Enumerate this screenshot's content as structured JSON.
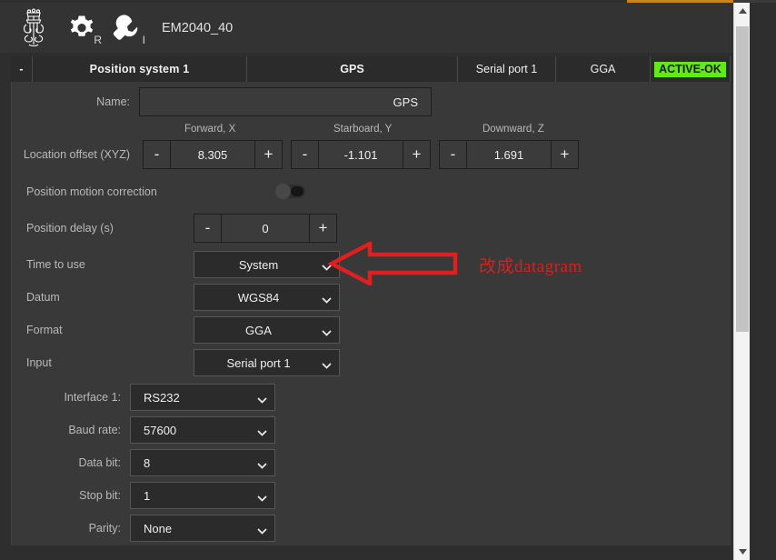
{
  "titlebar": {
    "logo_name": "kongsberg-crown-logo",
    "gear_sub": "R",
    "wrench_sub": "I",
    "device_name": "EM2040_40"
  },
  "tabstrip": {
    "collapse_label": "-",
    "title": "Position system 1",
    "name_tab": "GPS",
    "port_tab": "Serial port 1",
    "format_tab": "GGA",
    "status": "ACTIVE-OK",
    "status_color": "#63e81a"
  },
  "form": {
    "name": {
      "label": "Name:",
      "value": "GPS"
    },
    "location_offset": {
      "label": "Location offset (XYZ)",
      "axes": [
        {
          "header": "Forward, X",
          "value": "8.305",
          "minus": "-",
          "plus": "+"
        },
        {
          "header": "Starboard, Y",
          "value": "-1.101",
          "minus": "-",
          "plus": "+"
        },
        {
          "header": "Downward, Z",
          "value": "1.691",
          "minus": "-",
          "plus": "+"
        }
      ]
    },
    "motion_correction": {
      "label": "Position motion correction",
      "state": "off"
    },
    "position_delay": {
      "label": "Position delay (s)",
      "value": "0",
      "minus": "-",
      "plus": "+"
    },
    "time_to_use": {
      "label": "Time to use",
      "value": "System"
    },
    "datum": {
      "label": "Datum",
      "value": "WGS84"
    },
    "format": {
      "label": "Format",
      "value": "GGA"
    },
    "input": {
      "label": "Input",
      "value": "Serial port 1"
    },
    "interface": {
      "label": "Interface 1:",
      "value": "RS232"
    },
    "baud_rate": {
      "label": "Baud rate:",
      "value": "57600"
    },
    "data_bit": {
      "label": "Data bit:",
      "value": "8"
    },
    "stop_bit": {
      "label": "Stop bit:",
      "value": "1"
    },
    "parity": {
      "label": "Parity:",
      "value": "None"
    }
  },
  "annotation": {
    "text": "改成datagram",
    "color": "#d62020",
    "arrow_direction": "left"
  },
  "scrollbar": {
    "up_arrow": "▲",
    "down_arrow": "▼"
  }
}
